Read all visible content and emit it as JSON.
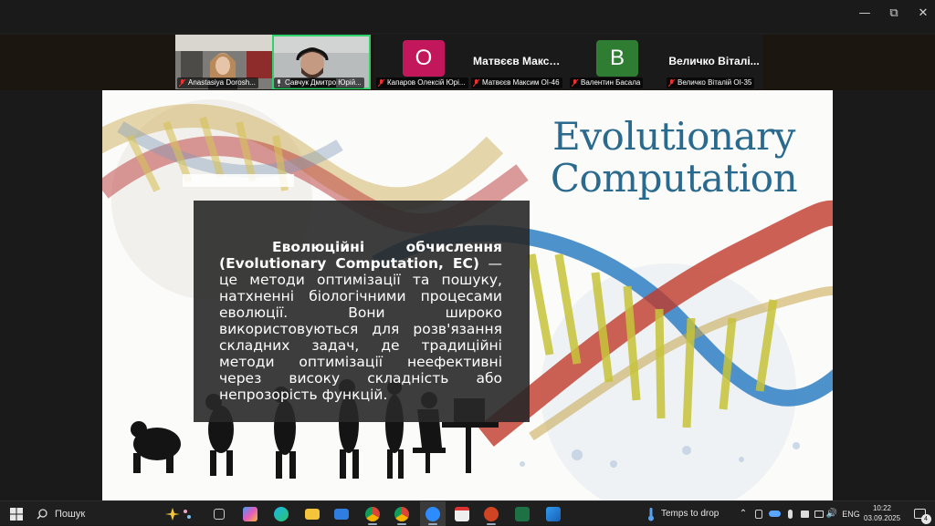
{
  "window": {
    "controls": {
      "minimize": "—",
      "maximize": "⧉",
      "close": "✕"
    }
  },
  "participants": [
    {
      "name": "Anastasiya Dorosh...",
      "type": "video",
      "muted": true
    },
    {
      "name": "Савчук Дмитро Юрій...",
      "type": "video",
      "muted": false,
      "active": true
    },
    {
      "name": "Капаров Олексій Юрі...",
      "type": "avatar",
      "initial": "O",
      "color": "#c2185b",
      "muted": true
    },
    {
      "name": "Матвєєв Максим ОІ-46",
      "type": "name",
      "title": "Матвєєв Макси...",
      "muted": true
    },
    {
      "name": "Валентин Басала",
      "type": "avatar",
      "initial": "В",
      "color": "#2e7d32",
      "muted": true
    },
    {
      "name": "Величко Віталій ОІ-35",
      "type": "name",
      "title": "Величко Віталі...",
      "muted": true
    }
  ],
  "slide": {
    "title_line1": "Evolutionary",
    "title_line2": "Computation",
    "body_bold": "Еволюційні обчислення (Evolutionary Computation, EC)",
    "body_text": " — це методи оптимізації та пошуку, натхненні біологічними процесами еволюції. Вони широко використовуються для розв'язання складних задач, де традиційні методи оптимізації неефективні через високу складність або непрозорість функцій."
  },
  "taskbar": {
    "search_label": "Пошук",
    "weather_text": "Temps to drop",
    "language": "ENG",
    "time": "10:22",
    "date": "03.09.2025",
    "notification_count": "4",
    "colors": {
      "accent": "#2fd36b",
      "title": "#2a6a8e"
    }
  }
}
